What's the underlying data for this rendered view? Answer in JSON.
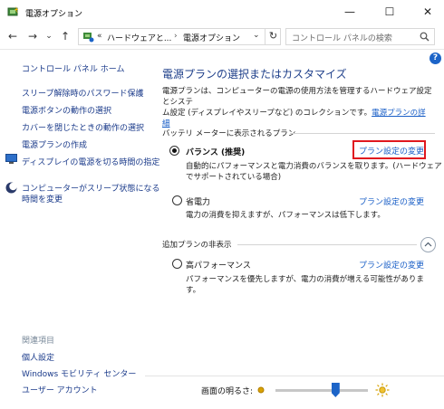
{
  "window": {
    "title": "電源オプション",
    "controls": {
      "minimize": "—",
      "maximize": "☐",
      "close": "✕"
    }
  },
  "nav": {
    "back": "←",
    "forward": "→",
    "recent": "⌄",
    "up": "↑",
    "breadcrumb_prefix": "«",
    "breadcrumb_1": "ハードウェアと...",
    "breadcrumb_sep": "›",
    "breadcrumb_2": "電源オプション",
    "dropdown": "⌄",
    "refresh": "↻",
    "search_placeholder": "コントロール パネルの検索"
  },
  "sidebar": {
    "home": "コントロール パネル ホーム",
    "links": [
      "スリープ解除時のパスワード保護",
      "電源ボタンの動作の選択",
      "カバーを閉じたときの動作の選択",
      "電源プランの作成",
      "ディスプレイの電源を切る時間の指定",
      "コンピューターがスリープ状態になる",
      "時間を変更"
    ],
    "related_heading": "関連項目",
    "related": [
      "個人設定",
      "Windows モビリティ センター",
      "ユーザー アカウント"
    ]
  },
  "main": {
    "help": "?",
    "title": "電源プランの選択またはカスタマイズ",
    "desc_line1": "電源プランは、コンピューターの電源の使用方法を管理するハードウェア設定とシステ",
    "desc_line2": "ム設定 (ディスプレイやスリープなど) のコレクションです。",
    "desc_link1": "電源プランの詳",
    "desc_link2": "細",
    "battery_group": "バッテリ メーターに表示されるプラン",
    "plans": [
      {
        "name": "バランス (推奨)",
        "desc1": "自動的にパフォーマンスと電力消費のバランスを取ります。(ハードウェア",
        "desc2": "でサポートされている場合)",
        "link": "プラン設定の変更"
      },
      {
        "name": "省電力",
        "desc1": "電力の消費を抑えますが、パフォーマンスは低下します。",
        "link": "プラン設定の変更"
      }
    ],
    "additional_group": "追加プランの非表示",
    "additional_plan": {
      "name": "高パフォーマンス",
      "desc1": "パフォーマンスを優先しますが、電力の消費が増える可能性がありま",
      "desc2": "す。",
      "link": "プラン設定の変更"
    },
    "selected_plan_index": 0
  },
  "brightness": {
    "label": "画面の明るさ:",
    "level_percent": 65
  },
  "colors": {
    "link": "#1a5fc7",
    "title": "#1e3f8a",
    "highlight": "#e0181f",
    "accent": "#1c64c8"
  }
}
